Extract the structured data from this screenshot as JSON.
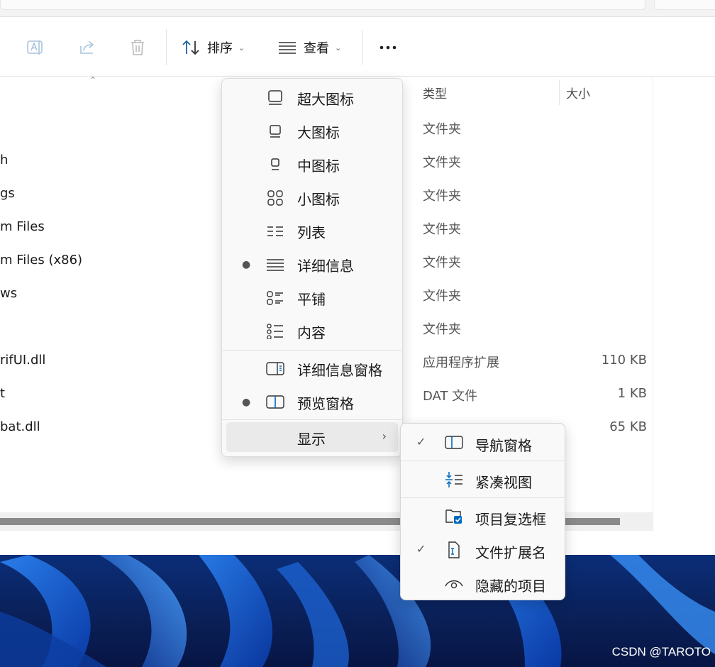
{
  "toolbar": {
    "rename_icon": "rename-icon",
    "share_icon": "share-icon",
    "delete_icon": "trash-icon",
    "sort_label": "排序",
    "view_label": "查看",
    "more_icon": "more-icon"
  },
  "columns": {
    "type": "类型",
    "size": "大小"
  },
  "files": [
    {
      "name": "h",
      "type": "文件夹",
      "size": ""
    },
    {
      "name": "gs",
      "type": "文件夹",
      "size": ""
    },
    {
      "name": "m Files",
      "type": "文件夹",
      "size": ""
    },
    {
      "name": "m Files (x86)",
      "type": "文件夹",
      "size": ""
    },
    {
      "name": "ws",
      "type": "文件夹",
      "size": ""
    },
    {
      "name": "",
      "type": "文件夹",
      "size": ""
    },
    {
      "name": "rifUI.dll",
      "type": "应用程序扩展",
      "size": "110 KB"
    },
    {
      "name": "t",
      "type": "DAT 文件",
      "size": "1 KB"
    },
    {
      "name": "bat.dll",
      "type": "",
      "size": "65 KB"
    }
  ],
  "first_type_cell": "文件夹",
  "view_menu": {
    "items": [
      {
        "label": "超大图标",
        "icon": "extra-large-icons-icon",
        "selected": false
      },
      {
        "label": "大图标",
        "icon": "large-icons-icon",
        "selected": false
      },
      {
        "label": "中图标",
        "icon": "medium-icons-icon",
        "selected": false
      },
      {
        "label": "小图标",
        "icon": "small-icons-icon",
        "selected": false
      },
      {
        "label": "列表",
        "icon": "list-icon",
        "selected": false
      },
      {
        "label": "详细信息",
        "icon": "details-icon",
        "selected": true
      },
      {
        "label": "平铺",
        "icon": "tiles-icon",
        "selected": false
      },
      {
        "label": "内容",
        "icon": "content-icon",
        "selected": false
      }
    ],
    "pane_items": [
      {
        "label": "详细信息窗格",
        "icon": "details-pane-icon",
        "selected": false
      },
      {
        "label": "预览窗格",
        "icon": "preview-pane-icon",
        "selected": true
      }
    ],
    "show_label": "显示"
  },
  "show_submenu": {
    "items": [
      {
        "label": "导航窗格",
        "icon": "navigation-pane-icon",
        "checked": true
      },
      {
        "label": "紧凑视图",
        "icon": "compact-view-icon",
        "checked": false
      },
      {
        "label": "项目复选框",
        "icon": "item-checkboxes-icon",
        "checked": false
      },
      {
        "label": "文件扩展名",
        "icon": "file-extensions-icon",
        "checked": true
      },
      {
        "label": "隐藏的项目",
        "icon": "hidden-items-icon",
        "checked": false
      }
    ]
  },
  "watermark": "CSDN @TAROTO",
  "colors": {
    "accent": "#0067c0",
    "disabled_icon": "#a9c4dc",
    "menu_bg": "#f9f9f9"
  }
}
